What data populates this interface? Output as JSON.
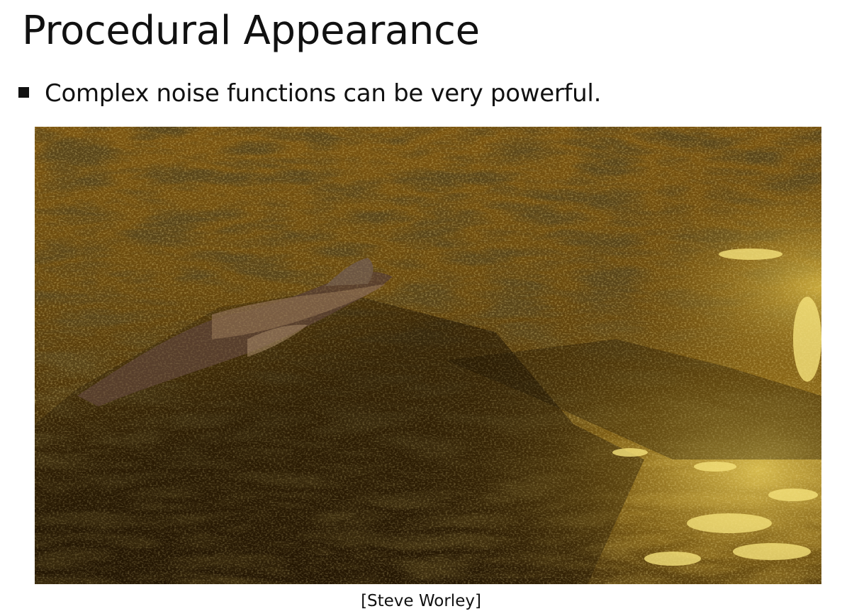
{
  "slide": {
    "title": "Procedural Appearance",
    "bullets": [
      {
        "text": "Complex noise functions can be very powerful."
      }
    ],
    "image": {
      "description_icon": "ocean-render-image"
    },
    "caption": "[Steve Worley]"
  },
  "colors": {
    "water_dark": "#2a1a04",
    "water_mid": "#6b4a0e",
    "water_bright": "#d8b83a",
    "highlight": "#f5e27a"
  }
}
